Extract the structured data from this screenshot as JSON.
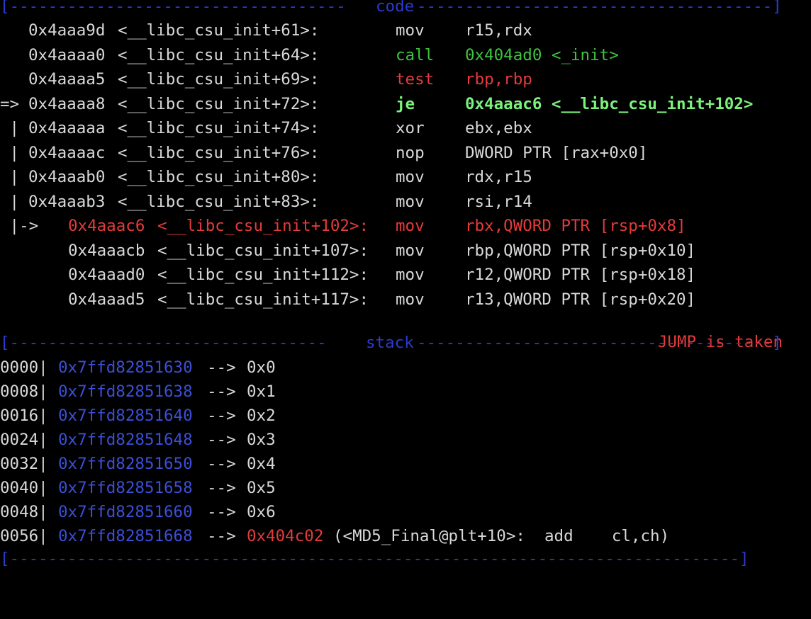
{
  "headers": {
    "code": "code",
    "stack": "stack"
  },
  "code_lines": [
    {
      "marker": "",
      "addr": "0x4aaa9d",
      "sym": "<__libc_csu_init+61>:",
      "mnem": "mov",
      "ops": "r15,rdx",
      "style": "normal"
    },
    {
      "marker": "",
      "addr": "0x4aaaa0",
      "sym": "<__libc_csu_init+64>:",
      "mnem": "call",
      "ops": "0x404ad0 <_init>",
      "style": "call"
    },
    {
      "marker": "",
      "addr": "0x4aaaa5",
      "sym": "<__libc_csu_init+69>:",
      "mnem": "test",
      "ops": "rbp,rbp",
      "style": "test"
    },
    {
      "marker": "=>",
      "addr": "0x4aaaa8",
      "sym": "<__libc_csu_init+72>:",
      "mnem": "je",
      "ops": "0x4aaac6 <__libc_csu_init+102>",
      "style": "current"
    },
    {
      "marker": " |",
      "addr": "0x4aaaaa",
      "sym": "<__libc_csu_init+74>:",
      "mnem": "xor",
      "ops": "ebx,ebx",
      "style": "normal"
    },
    {
      "marker": " |",
      "addr": "0x4aaaac",
      "sym": "<__libc_csu_init+76>:",
      "mnem": "nop",
      "ops": "DWORD PTR [rax+0x0]",
      "style": "normal"
    },
    {
      "marker": " |",
      "addr": "0x4aaab0",
      "sym": "<__libc_csu_init+80>:",
      "mnem": "mov",
      "ops": "rdx,r15",
      "style": "normal"
    },
    {
      "marker": " |",
      "addr": "0x4aaab3",
      "sym": "<__libc_csu_init+83>:",
      "mnem": "mov",
      "ops": "rsi,r14",
      "style": "normal"
    },
    {
      "marker": " |->",
      "addr": "0x4aaac6",
      "sym": "<__libc_csu_init+102>:",
      "mnem": "mov",
      "ops": "rbx,QWORD PTR [rsp+0x8]",
      "style": "target"
    },
    {
      "marker": "",
      "addr": "0x4aaacb",
      "sym": "<__libc_csu_init+107>:",
      "mnem": "mov",
      "ops": "rbp,QWORD PTR [rsp+0x10]",
      "style": "after"
    },
    {
      "marker": "",
      "addr": "0x4aaad0",
      "sym": "<__libc_csu_init+112>:",
      "mnem": "mov",
      "ops": "r12,QWORD PTR [rsp+0x18]",
      "style": "after"
    },
    {
      "marker": "",
      "addr": "0x4aaad5",
      "sym": "<__libc_csu_init+117>:",
      "mnem": "mov",
      "ops": "r13,QWORD PTR [rsp+0x20]",
      "style": "after"
    }
  ],
  "jump_status": "JUMP is taken",
  "stack_lines": [
    {
      "offset": "0000|",
      "addr": "0x7ffd82851630",
      "arrow": "-->",
      "value": "0x0",
      "extra": ""
    },
    {
      "offset": "0008|",
      "addr": "0x7ffd82851638",
      "arrow": "-->",
      "value": "0x1",
      "extra": ""
    },
    {
      "offset": "0016|",
      "addr": "0x7ffd82851640",
      "arrow": "-->",
      "value": "0x2",
      "extra": ""
    },
    {
      "offset": "0024|",
      "addr": "0x7ffd82851648",
      "arrow": "-->",
      "value": "0x3",
      "extra": ""
    },
    {
      "offset": "0032|",
      "addr": "0x7ffd82851650",
      "arrow": "-->",
      "value": "0x4",
      "extra": ""
    },
    {
      "offset": "0040|",
      "addr": "0x7ffd82851658",
      "arrow": "-->",
      "value": "0x5",
      "extra": ""
    },
    {
      "offset": "0048|",
      "addr": "0x7ffd82851660",
      "arrow": "-->",
      "value": "0x6",
      "extra": ""
    },
    {
      "offset": "0056|",
      "addr": "0x7ffd82851668",
      "arrow": "-->",
      "value": "0x404c02",
      "extra": "(<MD5_Final@plt+10>:  add    cl,ch)"
    }
  ],
  "colors": {
    "background": "#000000",
    "text": "#d8d8d8",
    "separator": "#2b3bcc",
    "call": "#3fc43f",
    "current": "#7cf27c",
    "red": "#e43b3b",
    "stack_addr": "#3b4fd8"
  }
}
